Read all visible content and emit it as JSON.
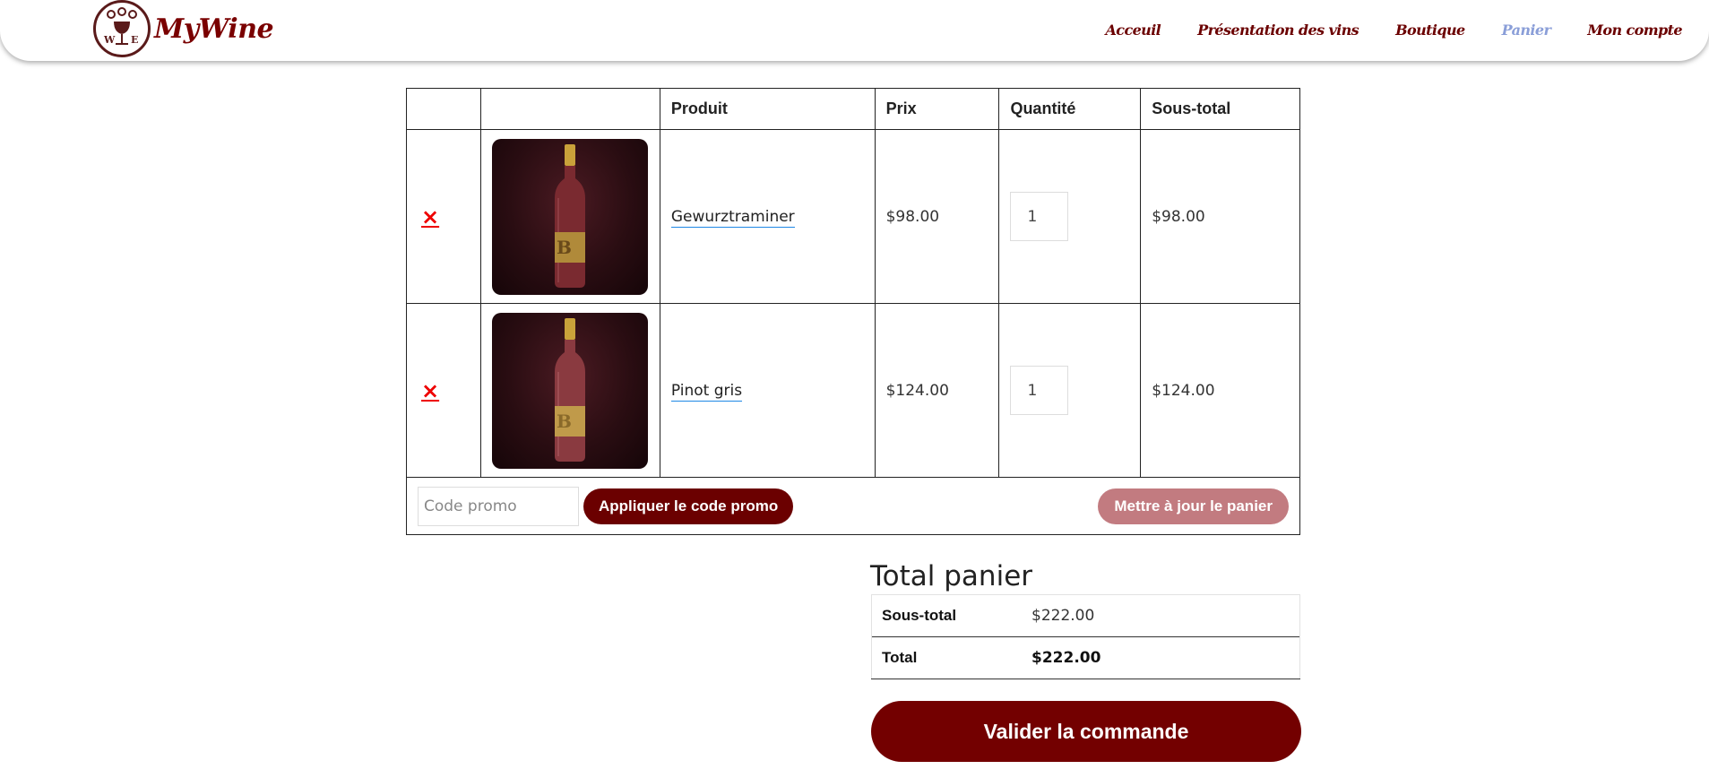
{
  "brand": {
    "name": "MyWine"
  },
  "nav": {
    "items": [
      {
        "label": "Acceuil",
        "active": false
      },
      {
        "label": "Présentation des vins",
        "active": false
      },
      {
        "label": "Boutique",
        "active": false
      },
      {
        "label": "Panier",
        "active": true
      },
      {
        "label": "Mon compte",
        "active": false
      }
    ],
    "active_color": "#8a9ed8",
    "color": "#6b0000"
  },
  "cart": {
    "headers": [
      "",
      "",
      "Produit",
      "Prix",
      "Quantité",
      "Sous-total"
    ],
    "rows": [
      {
        "remove": "×",
        "image": "wine-bottle-image",
        "product": "Gewurztraminer",
        "price": "$98.00",
        "quantity": "1",
        "subtotal": "$98.00"
      },
      {
        "remove": "×",
        "image": "wine-bottle-image",
        "product": "Pinot gris",
        "price": "$124.00",
        "quantity": "1",
        "subtotal": "$124.00"
      }
    ],
    "coupon_placeholder": "Code promo",
    "apply_coupon_label": "Appliquer le code promo",
    "update_cart_label": "Mettre à jour le panier"
  },
  "totals": {
    "title": "Total panier",
    "subtotal_label": "Sous-total",
    "subtotal_value": "$222.00",
    "total_label": "Total",
    "total_value": "$222.00",
    "checkout_label": "Valider la commande"
  },
  "colors": {
    "brand": "#730000",
    "update_button": "#c27b80",
    "remove_icon": "#e00000",
    "link_underline": "#1e88e5"
  }
}
